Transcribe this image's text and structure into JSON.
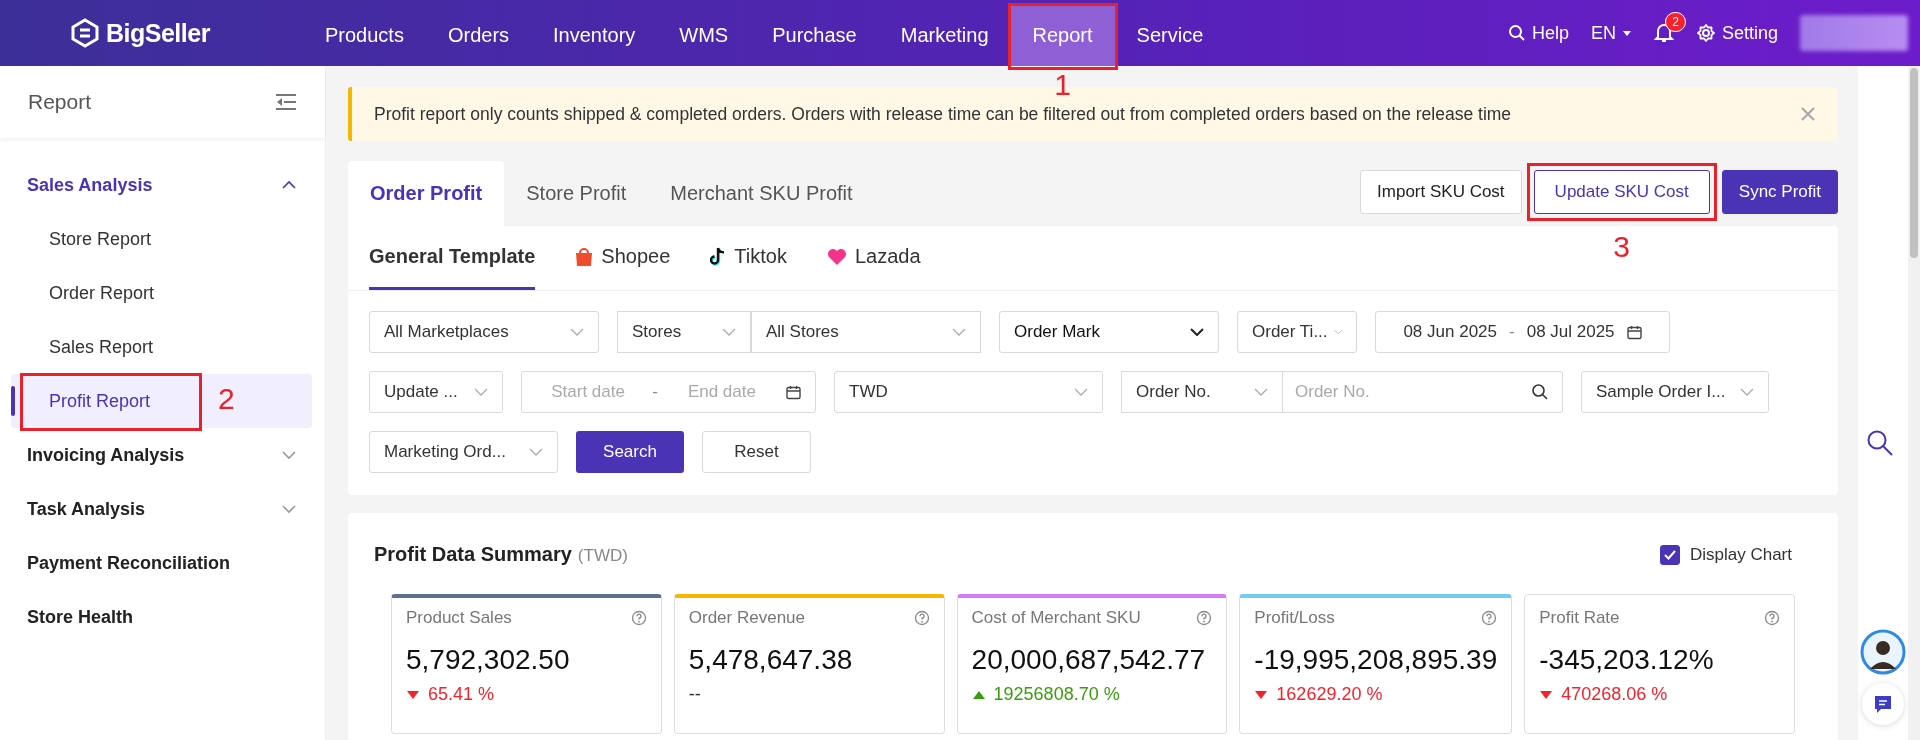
{
  "topbar": {
    "logo": "BigSeller",
    "nav": [
      {
        "label": "Products",
        "selected": false
      },
      {
        "label": "Orders",
        "selected": false
      },
      {
        "label": "Inventory",
        "selected": false
      },
      {
        "label": "WMS",
        "selected": false
      },
      {
        "label": "Purchase",
        "selected": false
      },
      {
        "label": "Marketing",
        "selected": false
      },
      {
        "label": "Report",
        "selected": true,
        "callout": "1"
      },
      {
        "label": "Service",
        "selected": false
      }
    ],
    "help": "Help",
    "language": "EN",
    "notifications": "2",
    "setting": "Setting"
  },
  "sidebar": {
    "title": "Report",
    "items": [
      {
        "label": "Sales Analysis",
        "expanded": true,
        "children": [
          {
            "label": "Store Report",
            "selected": false
          },
          {
            "label": "Order Report",
            "selected": false
          },
          {
            "label": "Sales Report",
            "selected": false
          },
          {
            "label": "Profit Report",
            "selected": true,
            "callout": "2"
          }
        ]
      },
      {
        "label": "Invoicing Analysis",
        "expanded": false
      },
      {
        "label": "Task Analysis",
        "expanded": false
      },
      {
        "label": "Payment Reconciliation"
      },
      {
        "label": "Store Health"
      }
    ]
  },
  "alert": "Profit report only counts shipped & completed orders. Orders with release time can be filtered out from completed orders based on the release time",
  "tabs": [
    {
      "label": "Order Profit",
      "selected": true
    },
    {
      "label": "Store Profit",
      "selected": false
    },
    {
      "label": "Merchant SKU Profit",
      "selected": false
    }
  ],
  "actions": [
    {
      "label": "Import SKU Cost",
      "kind": "default"
    },
    {
      "label": "Update SKU Cost",
      "kind": "outline",
      "callout": "3"
    },
    {
      "label": "Sync Profit",
      "kind": "primary"
    }
  ],
  "platform_tabs": [
    {
      "label": "General Template",
      "selected": true,
      "kind": "none"
    },
    {
      "label": "Shopee",
      "selected": false,
      "kind": "shopee"
    },
    {
      "label": "Tiktok",
      "selected": false,
      "kind": "tiktok"
    },
    {
      "label": "Lazada",
      "selected": false,
      "kind": "lazada"
    }
  ],
  "filters": [
    [
      {
        "kind": "select",
        "value": "All Marketplaces"
      },
      {
        "kind": "select-pair",
        "values": [
          "Stores",
          "All Stores"
        ]
      },
      {
        "kind": "dropdown",
        "value": "Order Mark"
      },
      {
        "kind": "select",
        "value": "Order Ti..."
      },
      {
        "kind": "date-range",
        "start": "08 Jun 2025",
        "separator": "-",
        "end": "08 Jul 2025"
      }
    ],
    [
      {
        "kind": "select",
        "value": "Update ..."
      },
      {
        "kind": "date-range",
        "start_placeholder": "Start date",
        "separator": "-",
        "end_placeholder": "End date"
      },
      {
        "kind": "select",
        "value": "TWD"
      },
      {
        "kind": "select-search",
        "value": "Order No.",
        "placeholder": "Order No."
      },
      {
        "kind": "select",
        "value": "Sample Order I..."
      }
    ],
    [
      {
        "kind": "select",
        "value": "Marketing Ord..."
      },
      {
        "kind": "primary",
        "value": "Search"
      },
      {
        "kind": "default",
        "value": "Reset"
      }
    ]
  ],
  "summary": {
    "title": "Profit Data Summary",
    "currency": "(TWD)",
    "display_chart": {
      "label": "Display Chart",
      "checked": true
    },
    "cards": [
      {
        "label": "Product Sales",
        "value": "5,792,302.50",
        "change": "65.41 %",
        "kind": "down",
        "color": "#5e6f8f"
      },
      {
        "label": "Order Revenue",
        "value": "5,478,647.38",
        "change": "--",
        "kind": "flat",
        "color": "#f5b800"
      },
      {
        "label": "Cost of Merchant SKU",
        "value": "20,000,687,542.77",
        "change": "19256808.70 %",
        "kind": "up",
        "color": "#d57cf5"
      },
      {
        "label": "Profit/Loss",
        "value": "-19,995,208,895.39",
        "change": "162629.20 %",
        "kind": "down",
        "color": "#72cdf4"
      },
      {
        "label": "Profit Rate",
        "value": "-345,203.12%",
        "change": "470268.06 %",
        "kind": "down"
      }
    ]
  }
}
